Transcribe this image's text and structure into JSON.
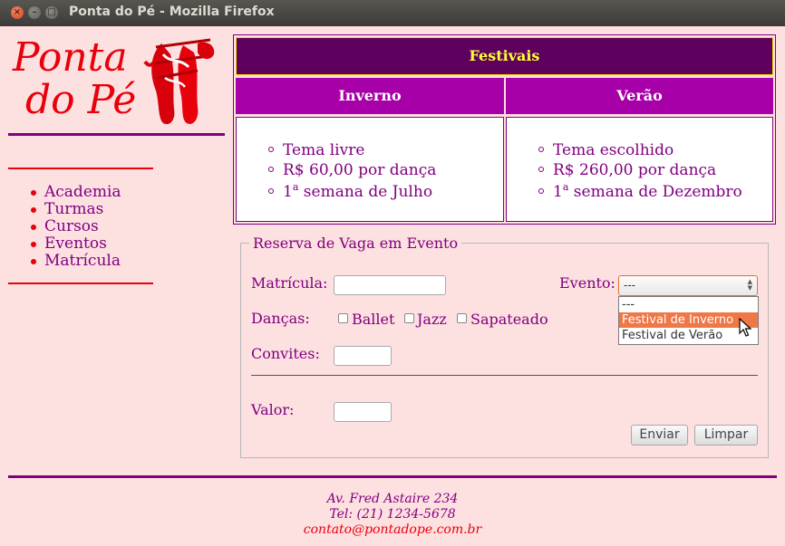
{
  "window": {
    "title": "Ponta do Pé - Mozilla Firefox",
    "close_glyph": "×",
    "min_glyph": "–",
    "max_glyph": "□"
  },
  "logo": {
    "line1": "Ponta",
    "line2": "do Pé",
    "image": "ballet-shoes-icon"
  },
  "nav": {
    "items": [
      "Academia",
      "Turmas",
      "Cursos",
      "Eventos",
      "Matrícula"
    ]
  },
  "festivals": {
    "title": "Festivais",
    "columns": [
      {
        "name": "Inverno",
        "items": [
          "Tema livre",
          "R$ 60,00 por dança",
          "1",
          "semana de Julho"
        ],
        "ordinal": "a"
      },
      {
        "name": "Verão",
        "items": [
          "Tema escolhido",
          "R$ 260,00 por dança",
          "1",
          "semana de Dezembro"
        ],
        "ordinal": "a"
      }
    ]
  },
  "form": {
    "legend": "Reserva de Vaga em Evento",
    "matricula_label": "Matrícula:",
    "evento_label": "Evento:",
    "evento_selected": "---",
    "evento_options": [
      "---",
      "Festival de Inverno",
      "Festival de Verão"
    ],
    "dancas_label": "Danças:",
    "dancas_options": [
      "Ballet",
      "Jazz",
      "Sapateado"
    ],
    "convites_label": "Convites:",
    "valor_label": "Valor:",
    "submit_label": "Enviar",
    "reset_label": "Limpar"
  },
  "footer": {
    "address": "Av. Fred Astaire 234",
    "phone": "Tel: (21) 1234-5678",
    "email": "contato@pontadope.com.br"
  },
  "colors": {
    "background": "#fde0e0",
    "purple": "#800080",
    "red": "#e8000b",
    "header_dark": "#5e005e",
    "header_mid": "#a800a8",
    "highlight": "#f07746"
  }
}
